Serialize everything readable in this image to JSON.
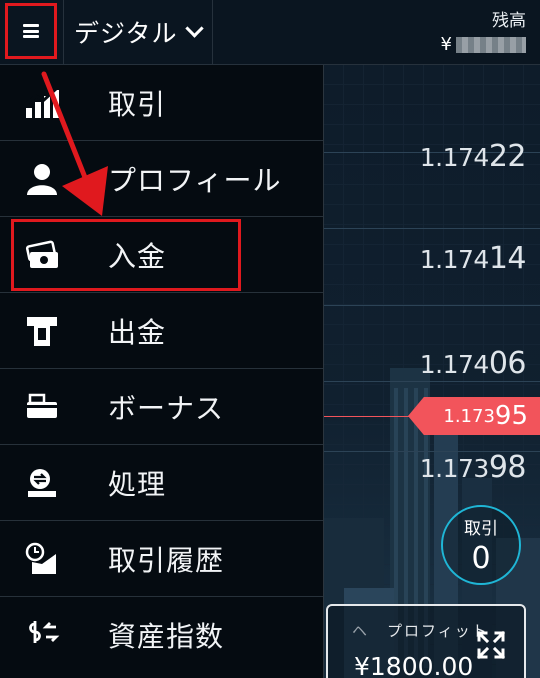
{
  "header": {
    "mode_label": "デジタル",
    "balance_label": "残高",
    "balance_currency": "¥"
  },
  "menu": {
    "items": [
      {
        "label": "取引",
        "icon": "chart-trade-icon"
      },
      {
        "label": "プロフィール",
        "icon": "user-icon"
      },
      {
        "label": "入金",
        "icon": "deposit-cash-icon"
      },
      {
        "label": "出金",
        "icon": "withdraw-atm-icon"
      },
      {
        "label": "ボーナス",
        "icon": "bonus-card-icon"
      },
      {
        "label": "処理",
        "icon": "transactions-icon"
      },
      {
        "label": "取引履歴",
        "icon": "history-clock-icon"
      },
      {
        "label": "資産指数",
        "icon": "asset-index-icon"
      }
    ],
    "highlighted_item": "入金"
  },
  "chart": {
    "prices": [
      {
        "main": "1.174",
        "big": "22"
      },
      {
        "main": "1.174",
        "big": "14"
      },
      {
        "main": "1.174",
        "big": "06"
      },
      {
        "main": "1.173",
        "big": "98"
      }
    ],
    "current_price": {
      "main": "1.173",
      "big": "95"
    },
    "current_color": "#f2545b"
  },
  "trade_counter": {
    "label": "取引",
    "count": "0"
  },
  "profit": {
    "label": "プロフィット",
    "value": "¥1800.00"
  },
  "colors": {
    "accent": "#1fb6d6",
    "highlight": "#e0191e",
    "drawer_bg": "#050b11"
  }
}
